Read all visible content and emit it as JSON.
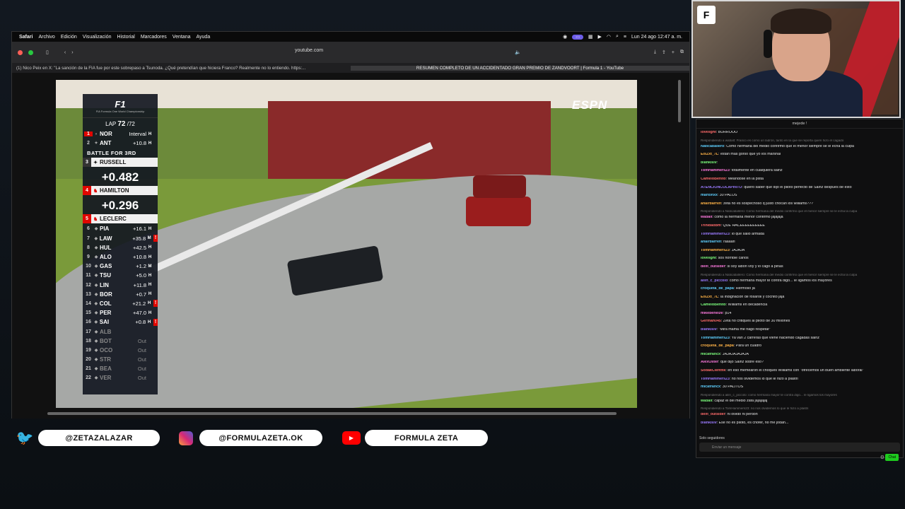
{
  "menubar": {
    "app": "Safari",
    "items": [
      "Archivo",
      "Edición",
      "Visualización",
      "Historial",
      "Marcadores",
      "Ventana",
      "Ayuda"
    ],
    "clock": "Lun 24 ago 12:47 a. m."
  },
  "browser": {
    "url": "youtube.com",
    "tabs": [
      "(1) Nico Peix en X: \"La sanción de la FIA fue por este sobrepaso a Tsunoda. ¿Qué pretendían que hiciera Franco? Realmente no lo entiendo. https:...",
      "RESUMEN COMPLETO DE UN ACCIDENTADO GRAN PREMIO DE ZANDVOORT | Formula 1 - YouTube"
    ]
  },
  "video": {
    "broadcaster": "ESPN",
    "leaderboard": {
      "logo": "F1",
      "logo_sub": "FIA Formula One World Championship",
      "lap_label": "LAP",
      "lap_current": "72",
      "lap_total": "/72",
      "battle_label": "BATTLE FOR 3RD",
      "top": [
        {
          "pos": "1",
          "code": "NOR",
          "gap": "Interval",
          "tyre": "H"
        },
        {
          "pos": "2",
          "code": "ANT",
          "gap": "+10.8",
          "tyre": "H"
        }
      ],
      "battle": [
        {
          "pos": "3",
          "code": "RUSSELL",
          "gap": "+0.482"
        },
        {
          "pos": "4",
          "code": "HAMILTON",
          "gap": "+0.296"
        }
      ],
      "leclerc": {
        "pos": "5",
        "code": "LECLERC"
      },
      "rest": [
        {
          "pos": "6",
          "code": "PIA",
          "gap": "+16.1",
          "tyre": "H"
        },
        {
          "pos": "7",
          "code": "LAW",
          "gap": "+35.8",
          "tyre": "M",
          "flag": "!"
        },
        {
          "pos": "8",
          "code": "HUL",
          "gap": "+42.5",
          "tyre": "H"
        },
        {
          "pos": "9",
          "code": "ALO",
          "gap": "+10.8",
          "tyre": "H"
        },
        {
          "pos": "10",
          "code": "GAS",
          "gap": "+1.2",
          "tyre": "M"
        },
        {
          "pos": "11",
          "code": "TSU",
          "gap": "+5.0",
          "tyre": "H"
        },
        {
          "pos": "12",
          "code": "LIN",
          "gap": "+11.8",
          "tyre": "H"
        },
        {
          "pos": "13",
          "code": "BOR",
          "gap": "+0.7",
          "tyre": "H"
        },
        {
          "pos": "14",
          "code": "COL",
          "gap": "+21.2",
          "tyre": "H",
          "flag": "!"
        },
        {
          "pos": "15",
          "code": "PER",
          "gap": "+47.0",
          "tyre": "H"
        },
        {
          "pos": "16",
          "code": "SAI",
          "gap": "+0.8",
          "tyre": "H",
          "flag": "!"
        },
        {
          "pos": "17",
          "code": "ALB",
          "gap": "",
          "tyre": ""
        },
        {
          "pos": "18",
          "code": "BOT",
          "gap": "Out",
          "tyre": ""
        },
        {
          "pos": "19",
          "code": "OCO",
          "gap": "Out",
          "tyre": ""
        },
        {
          "pos": "20",
          "code": "STR",
          "gap": "Out",
          "tyre": ""
        },
        {
          "pos": "21",
          "code": "BEA",
          "gap": "Out",
          "tyre": ""
        },
        {
          "pos": "22",
          "code": "VER",
          "gap": "Out",
          "tyre": ""
        }
      ]
    }
  },
  "webcam": {
    "brand": "F"
  },
  "chat": {
    "pinned": "mejede !",
    "messages": [
      {
        "user": "lovelight",
        "text": ": BURROOO"
      },
      {
        "user": "",
        "text": "Respondiendo a wabalt: Franco es como un ladrón, tanto en la que se reporta quién hizo el cagado",
        "reply": true
      },
      {
        "user": "NaticabalIero",
        "text": ": Como hermana del medio confirmo que el menor siempre se le echa la culpa"
      },
      {
        "user": "ElsZxt_7L",
        "text": ": estan mas gorso que yo los marshal"
      },
      {
        "user": "blanklslv",
        "text": ":"
      },
      {
        "user": "TomHammers23",
        "text": ": totalmente en cualquiera sainz"
      },
      {
        "user": "CameloBenito",
        "text": ": Meandose en la pista"
      },
      {
        "user": "ATENCIONCOLAPINTO",
        "text": ": quiero saber que dijo el piloto perfecto de Sainz despues de esto"
      },
      {
        "user": "martonxx",
        "text": ": 30 PALOS"
      },
      {
        "user": "anairbarren",
        "text": ": zeta no es sospechoso q justo chocan los williams???"
      },
      {
        "user": "",
        "text": "Respondiendo a NaticabalIero: Como hermana del medio confirmo que el menor siempre se le echa la culpa",
        "reply": true
      },
      {
        "user": "wabalt",
        "text": ": como la hermana menor confirmo jajajaja"
      },
      {
        "user": "Trinidadbm",
        "text": ": QUE HACEEEEEEEEEE"
      },
      {
        "user": "TomHammers23",
        "text": ": lo que salio armada"
      },
      {
        "user": "anairbarren",
        "text": ": raaaari"
      },
      {
        "user": "TomHammers23",
        "text": ": JAJAJA"
      },
      {
        "user": "lovelight",
        "text": ": sos horrible carlos"
      },
      {
        "user": "delfi_outsider",
        "text": ": si soy albon voy y lo cago a piñas"
      },
      {
        "user": "",
        "text": "Respondiendo a NaticabalIero: Como hermana del medio confirmo que el menor siempre se le echa la culpa",
        "reply": true
      },
      {
        "user": "ailin_c_piccolo",
        "text": ": como hermana mayor te contra digo... le ligamos los mayores"
      },
      {
        "user": "croqueta_de_papa",
        "text": ": Hermoso ja"
      },
      {
        "user": "ElsZxt_7L",
        "text": ": la indignacion de fosaroli y cochito jaja"
      },
      {
        "user": "CameloBenito",
        "text": ": Williams en decadencia"
      },
      {
        "user": "mikebeneize",
        "text": ": p14"
      },
      {
        "user": "German045",
        "text": ": Zeta no critiques al piloto de 30 millones"
      },
      {
        "user": "blanklslv",
        "text": ": \"Mirá mamá me hago respetar\""
      },
      {
        "user": "TomHammers23",
        "text": ": Ya van 2 carreras que viene haciendo cagadas sainz"
      },
      {
        "user": "croqueta_de_papa",
        "text": ": Para un cuadro"
      },
      {
        "user": "micafrancx",
        "text": ": JAJAJAJAJAJA"
      },
      {
        "user": "AlexOster",
        "text": ": que dijo Sainz sobre eso?"
      },
      {
        "user": "SodakClentfik",
        "text": ": en eso memearon el choques Williams con \"ofrecemos un buen ambiente laboral\""
      },
      {
        "user": "TomHammers23",
        "text": ": no nos olvidemos lo que le hizo a plastri"
      },
      {
        "user": "micafrancx",
        "text": ": 30 PALITOS"
      },
      {
        "user": "",
        "text": "Respondiendo a ailin_c_piccolo: como hermana mayor te contra digo... le ligamos los mayores",
        "reply": true
      },
      {
        "user": "wabalt",
        "text": ": capaz el del medio zafa jajajajaj"
      },
      {
        "user": "",
        "text": "Respondiendo a TomHammers23: no nos olvidemos lo que le hizo a plastri",
        "reply": true
      },
      {
        "user": "delfi_outsider",
        "text": ": ni olvido ni perdon"
      },
      {
        "user": "blanklslv",
        "text": ": Ese no es piloto, es chofer, no me jodan..."
      }
    ],
    "subs_only": "Solo seguidores",
    "placeholder": "Enviar un mensaje",
    "send_label": "Chat"
  },
  "socials": {
    "twitter": "@ZETAZALAZAR",
    "instagram": "@FORMULAZETA.OK",
    "youtube": "FORMULA ZETA"
  },
  "colors": {
    "accent": "#e10600",
    "chat_send": "#1ecb1e",
    "twitter": "#1d9bf0",
    "youtube": "#ff0000"
  }
}
